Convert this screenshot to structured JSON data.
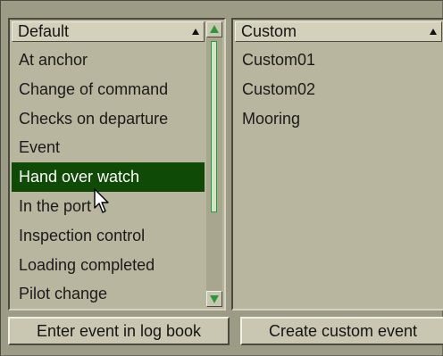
{
  "default_list": {
    "header": "Default",
    "items": [
      "At anchor",
      "Change of command",
      "Checks on departure",
      "Event",
      "Hand over watch",
      "In the port",
      "Inspection control",
      "Loading completed",
      "Pilot change"
    ],
    "selected_item": "Hand over watch"
  },
  "custom_list": {
    "header": "Custom",
    "items": [
      "Custom01",
      "Custom02",
      "Mooring"
    ]
  },
  "buttons": {
    "enter_event": "Enter event in log book",
    "create_custom": "Create custom event"
  },
  "colors": {
    "selection_background": "#0f4a06",
    "scrollbar_accent": "#2c9a3a",
    "panel_background": "#b9b69f"
  },
  "icons": {
    "sort": "sort-ascending-icon",
    "scroll_up": "arrow-up-icon",
    "scroll_down": "arrow-down-icon",
    "cursor": "mouse-pointer-icon"
  }
}
